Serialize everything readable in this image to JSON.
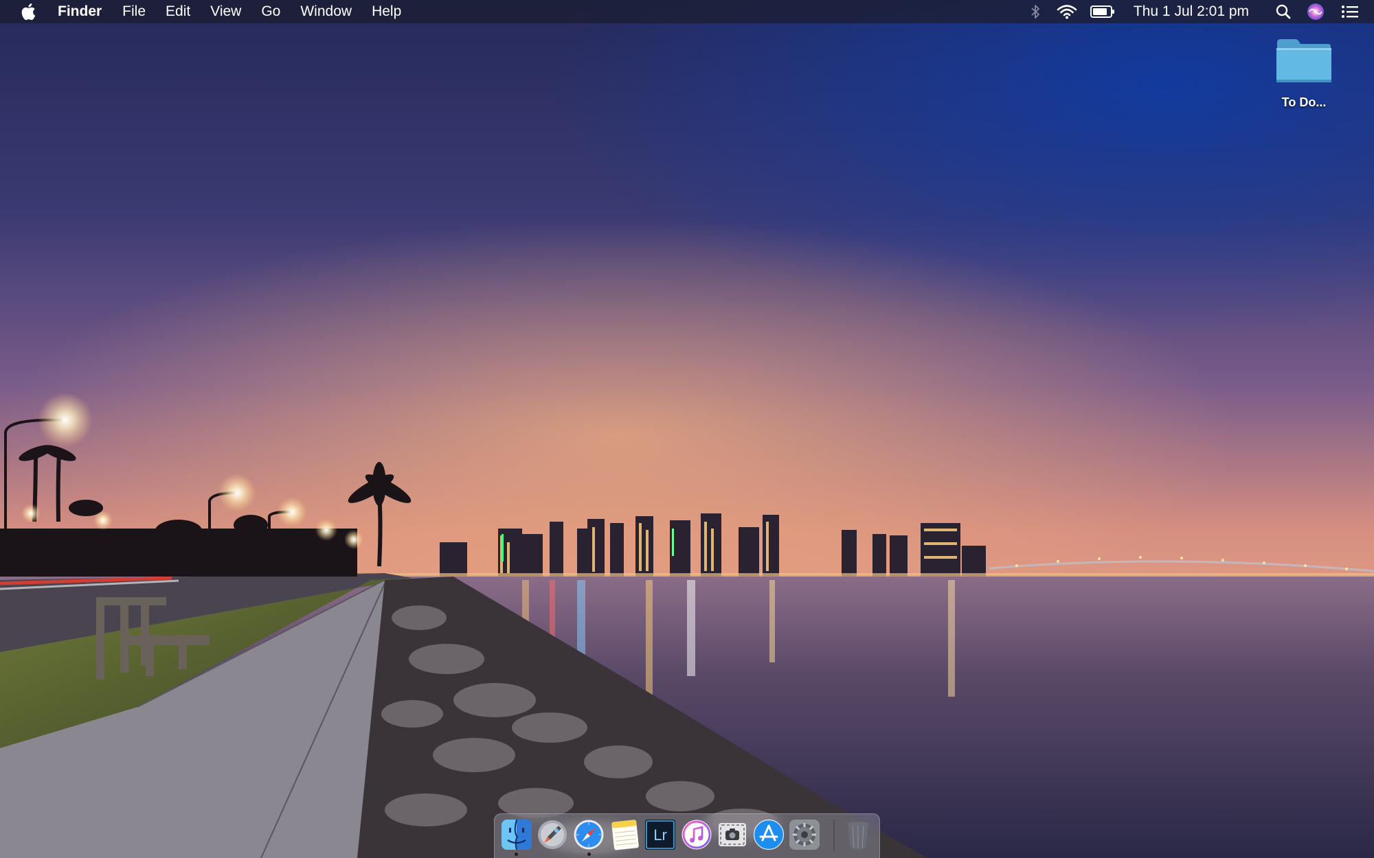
{
  "menubar": {
    "apple_icon": "apple-logo-icon",
    "app_name": "Finder",
    "menus": [
      "File",
      "Edit",
      "View",
      "Go",
      "Window",
      "Help"
    ],
    "status": {
      "bluetooth_icon": "bluetooth-icon",
      "wifi_icon": "wifi-icon",
      "battery_icon": "battery-icon",
      "clock": "Thu 1 Jul  2:01 pm",
      "spotlight_icon": "search-icon",
      "siri_icon": "siri-icon",
      "notification_icon": "notification-center-icon"
    }
  },
  "desktop": {
    "items": [
      {
        "label": "To Do...",
        "icon": "folder-icon"
      }
    ]
  },
  "dock": {
    "apps": [
      {
        "name": "Finder",
        "icon": "finder-icon",
        "running": true
      },
      {
        "name": "Launchpad",
        "icon": "launchpad-icon",
        "running": false
      },
      {
        "name": "Safari",
        "icon": "safari-icon",
        "running": true
      },
      {
        "name": "Notes",
        "icon": "notes-icon",
        "running": false
      },
      {
        "name": "Lightroom",
        "icon": "lightroom-icon",
        "label": "Lr",
        "running": false
      },
      {
        "name": "iTunes",
        "icon": "itunes-icon",
        "running": false
      },
      {
        "name": "Screenshot",
        "icon": "screenshot-icon",
        "running": false
      },
      {
        "name": "App Store",
        "icon": "app-store-icon",
        "running": false
      },
      {
        "name": "System Preferences",
        "icon": "system-preferences-icon",
        "running": false
      },
      {
        "name": "Trash",
        "icon": "trash-icon",
        "running": false
      }
    ]
  },
  "colors": {
    "menubar_bg": "#1c1e34",
    "folder_blue": "#5fb8e0",
    "sky_top": "#1f2a5c",
    "horizon_glow": "#e8a27a",
    "water": "#4a3a5a"
  }
}
